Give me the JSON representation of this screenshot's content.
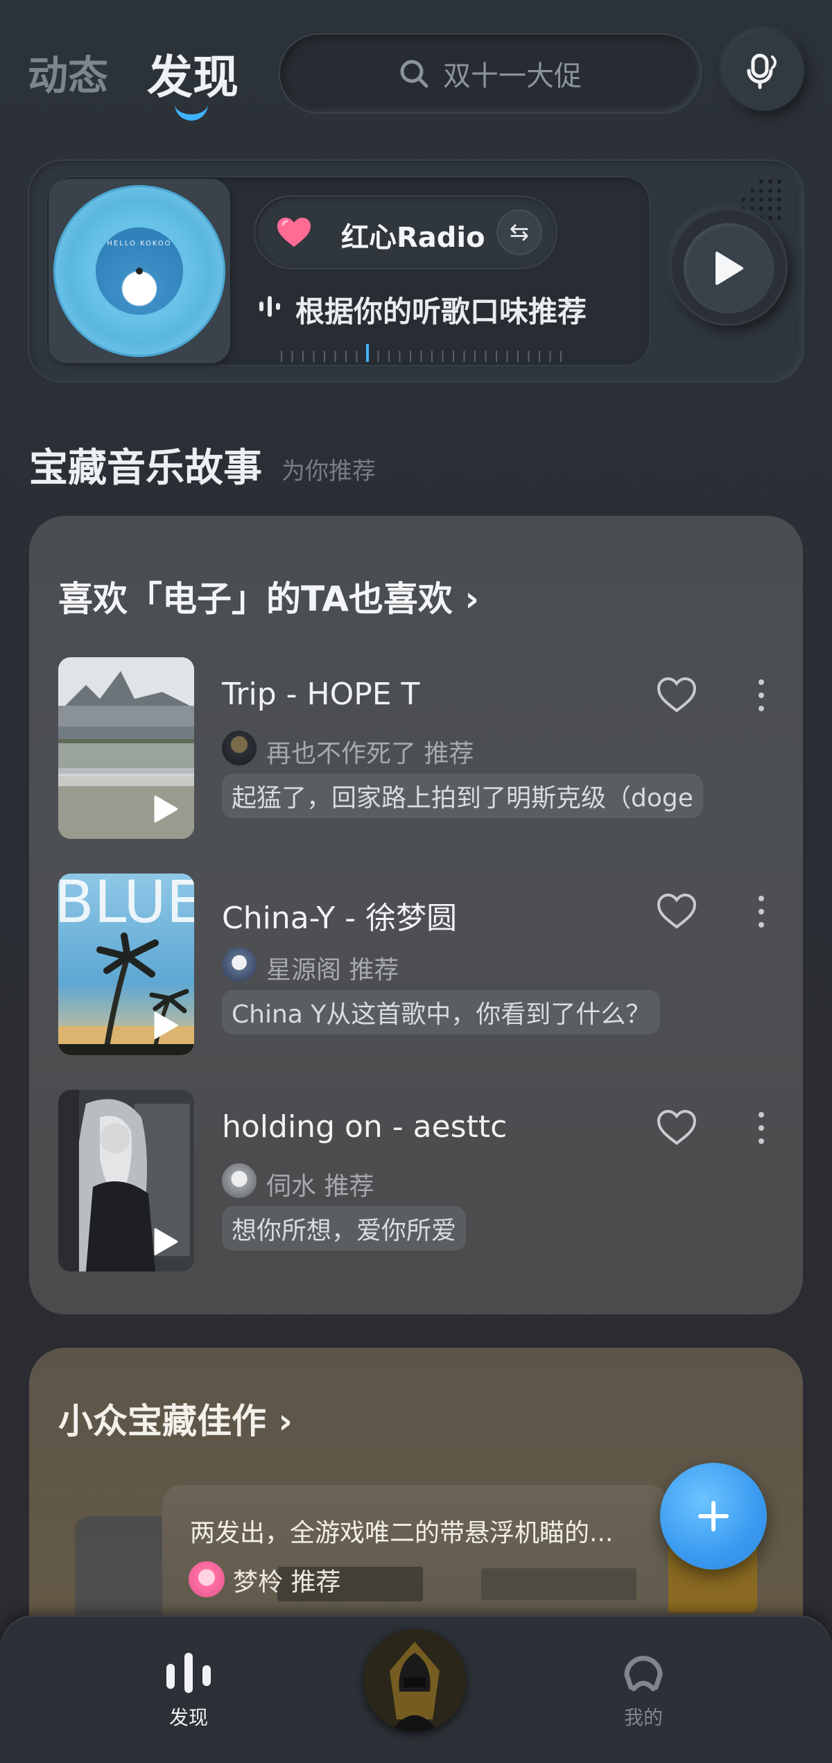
{
  "header": {
    "tab_dongtai": "动态",
    "tab_faxian": "发现",
    "search_placeholder": "双十一大促"
  },
  "radio": {
    "name": "红心Radio",
    "subtitle": "根据你的听歌口味推荐",
    "vinyl_text": "HELLO KOKOO"
  },
  "section": {
    "title": "宝藏音乐故事",
    "subtitle": "为你推荐"
  },
  "recommend_card": {
    "title": "喜欢「电子」的TA也喜欢 ›",
    "songs": [
      {
        "title": "Trip - HOPE T",
        "recommender": "再也不作死了 推荐",
        "comment": "起猛了，回家路上拍到了明斯克级（doge"
      },
      {
        "title": "China-Y - 徐梦圆",
        "recommender": "星源阁 推荐",
        "comment": "China Y从这首歌中，你看到了什么？",
        "cover_text": "BLUE"
      },
      {
        "title": "holding on - aesttc",
        "recommender": "伺水 推荐",
        "comment": "想你所想，爱你所爱"
      }
    ]
  },
  "niche_card": {
    "title": "小众宝藏佳作 ›",
    "post_text": "两发出，全游戏唯二的带悬浮机瞄的...",
    "recommender": "梦柃 推荐"
  },
  "bottom_nav": {
    "faxian": "发现",
    "mine": "我的"
  },
  "colors": {
    "accent": "#3fb3ff",
    "heart": "#ff5c8a",
    "fab": "#3a9af0"
  }
}
